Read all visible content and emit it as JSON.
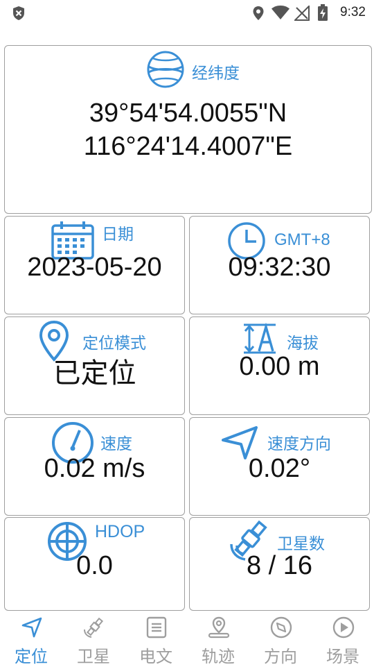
{
  "status_bar": {
    "time": "9:32"
  },
  "coordinates": {
    "label": "经纬度",
    "latitude": "39°54'54.0055\"N",
    "longitude": "116°24'14.4007\"E"
  },
  "cards": {
    "date": {
      "label": "日期",
      "value": "2023-05-20"
    },
    "time": {
      "label": "GMT+8",
      "value": "09:32:30"
    },
    "mode": {
      "label": "定位模式",
      "value": "已定位"
    },
    "altitude": {
      "label": "海拔",
      "value": "0.00 m"
    },
    "speed": {
      "label": "速度",
      "value": "0.02 m/s"
    },
    "heading": {
      "label": "速度方向",
      "value": "0.02°"
    },
    "hdop": {
      "label": "HDOP",
      "value": "0.0"
    },
    "satellites": {
      "label": "卫星数",
      "value": "8 / 16"
    }
  },
  "nav": {
    "items": [
      {
        "label": "定位",
        "icon": "navigation-arrow-icon",
        "active": true
      },
      {
        "label": "卫星",
        "icon": "satellite-icon",
        "active": false
      },
      {
        "label": "电文",
        "icon": "document-icon",
        "active": false
      },
      {
        "label": "轨迹",
        "icon": "map-pin-track-icon",
        "active": false
      },
      {
        "label": "方向",
        "icon": "compass-icon",
        "active": false
      },
      {
        "label": "场景",
        "icon": "play-circle-icon",
        "active": false
      }
    ]
  },
  "colors": {
    "accent": "#3a8fd6",
    "inactive": "#9e9e9e",
    "border": "#9e9e9e"
  }
}
